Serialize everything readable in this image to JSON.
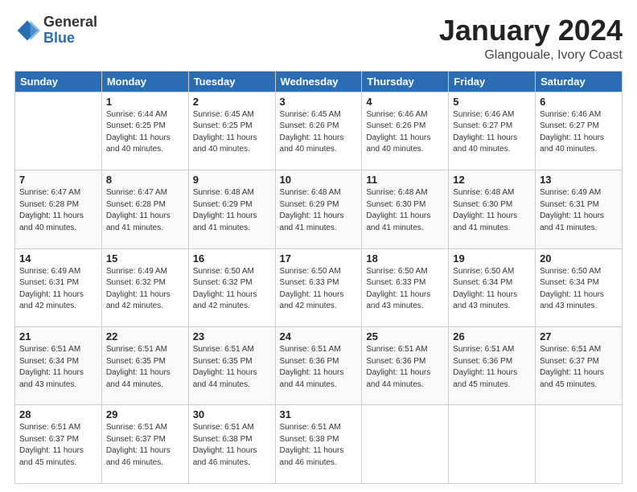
{
  "header": {
    "logo_general": "General",
    "logo_blue": "Blue",
    "title": "January 2024",
    "subtitle": "Glangouale, Ivory Coast"
  },
  "weekdays": [
    "Sunday",
    "Monday",
    "Tuesday",
    "Wednesday",
    "Thursday",
    "Friday",
    "Saturday"
  ],
  "weeks": [
    [
      {
        "day": "",
        "info": ""
      },
      {
        "day": "1",
        "info": "Sunrise: 6:44 AM\nSunset: 6:25 PM\nDaylight: 11 hours\nand 40 minutes."
      },
      {
        "day": "2",
        "info": "Sunrise: 6:45 AM\nSunset: 6:25 PM\nDaylight: 11 hours\nand 40 minutes."
      },
      {
        "day": "3",
        "info": "Sunrise: 6:45 AM\nSunset: 6:26 PM\nDaylight: 11 hours\nand 40 minutes."
      },
      {
        "day": "4",
        "info": "Sunrise: 6:46 AM\nSunset: 6:26 PM\nDaylight: 11 hours\nand 40 minutes."
      },
      {
        "day": "5",
        "info": "Sunrise: 6:46 AM\nSunset: 6:27 PM\nDaylight: 11 hours\nand 40 minutes."
      },
      {
        "day": "6",
        "info": "Sunrise: 6:46 AM\nSunset: 6:27 PM\nDaylight: 11 hours\nand 40 minutes."
      }
    ],
    [
      {
        "day": "7",
        "info": "Sunrise: 6:47 AM\nSunset: 6:28 PM\nDaylight: 11 hours\nand 40 minutes."
      },
      {
        "day": "8",
        "info": "Sunrise: 6:47 AM\nSunset: 6:28 PM\nDaylight: 11 hours\nand 41 minutes."
      },
      {
        "day": "9",
        "info": "Sunrise: 6:48 AM\nSunset: 6:29 PM\nDaylight: 11 hours\nand 41 minutes."
      },
      {
        "day": "10",
        "info": "Sunrise: 6:48 AM\nSunset: 6:29 PM\nDaylight: 11 hours\nand 41 minutes."
      },
      {
        "day": "11",
        "info": "Sunrise: 6:48 AM\nSunset: 6:30 PM\nDaylight: 11 hours\nand 41 minutes."
      },
      {
        "day": "12",
        "info": "Sunrise: 6:48 AM\nSunset: 6:30 PM\nDaylight: 11 hours\nand 41 minutes."
      },
      {
        "day": "13",
        "info": "Sunrise: 6:49 AM\nSunset: 6:31 PM\nDaylight: 11 hours\nand 41 minutes."
      }
    ],
    [
      {
        "day": "14",
        "info": "Sunrise: 6:49 AM\nSunset: 6:31 PM\nDaylight: 11 hours\nand 42 minutes."
      },
      {
        "day": "15",
        "info": "Sunrise: 6:49 AM\nSunset: 6:32 PM\nDaylight: 11 hours\nand 42 minutes."
      },
      {
        "day": "16",
        "info": "Sunrise: 6:50 AM\nSunset: 6:32 PM\nDaylight: 11 hours\nand 42 minutes."
      },
      {
        "day": "17",
        "info": "Sunrise: 6:50 AM\nSunset: 6:33 PM\nDaylight: 11 hours\nand 42 minutes."
      },
      {
        "day": "18",
        "info": "Sunrise: 6:50 AM\nSunset: 6:33 PM\nDaylight: 11 hours\nand 43 minutes."
      },
      {
        "day": "19",
        "info": "Sunrise: 6:50 AM\nSunset: 6:34 PM\nDaylight: 11 hours\nand 43 minutes."
      },
      {
        "day": "20",
        "info": "Sunrise: 6:50 AM\nSunset: 6:34 PM\nDaylight: 11 hours\nand 43 minutes."
      }
    ],
    [
      {
        "day": "21",
        "info": "Sunrise: 6:51 AM\nSunset: 6:34 PM\nDaylight: 11 hours\nand 43 minutes."
      },
      {
        "day": "22",
        "info": "Sunrise: 6:51 AM\nSunset: 6:35 PM\nDaylight: 11 hours\nand 44 minutes."
      },
      {
        "day": "23",
        "info": "Sunrise: 6:51 AM\nSunset: 6:35 PM\nDaylight: 11 hours\nand 44 minutes."
      },
      {
        "day": "24",
        "info": "Sunrise: 6:51 AM\nSunset: 6:36 PM\nDaylight: 11 hours\nand 44 minutes."
      },
      {
        "day": "25",
        "info": "Sunrise: 6:51 AM\nSunset: 6:36 PM\nDaylight: 11 hours\nand 44 minutes."
      },
      {
        "day": "26",
        "info": "Sunrise: 6:51 AM\nSunset: 6:36 PM\nDaylight: 11 hours\nand 45 minutes."
      },
      {
        "day": "27",
        "info": "Sunrise: 6:51 AM\nSunset: 6:37 PM\nDaylight: 11 hours\nand 45 minutes."
      }
    ],
    [
      {
        "day": "28",
        "info": "Sunrise: 6:51 AM\nSunset: 6:37 PM\nDaylight: 11 hours\nand 45 minutes."
      },
      {
        "day": "29",
        "info": "Sunrise: 6:51 AM\nSunset: 6:37 PM\nDaylight: 11 hours\nand 46 minutes."
      },
      {
        "day": "30",
        "info": "Sunrise: 6:51 AM\nSunset: 6:38 PM\nDaylight: 11 hours\nand 46 minutes."
      },
      {
        "day": "31",
        "info": "Sunrise: 6:51 AM\nSunset: 6:38 PM\nDaylight: 11 hours\nand 46 minutes."
      },
      {
        "day": "",
        "info": ""
      },
      {
        "day": "",
        "info": ""
      },
      {
        "day": "",
        "info": ""
      }
    ]
  ]
}
